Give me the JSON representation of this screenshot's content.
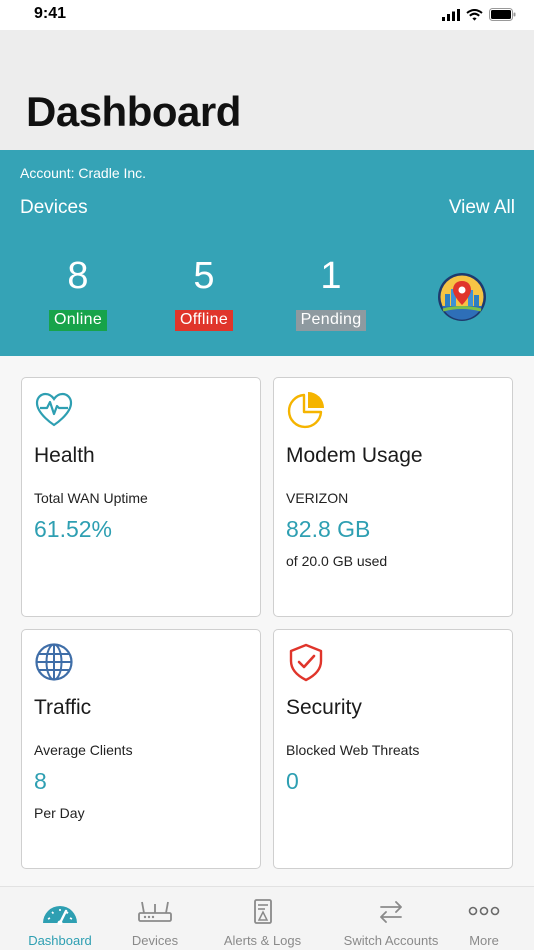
{
  "status_bar": {
    "time": "9:41"
  },
  "header": {
    "title": "Dashboard"
  },
  "devices_panel": {
    "account": "Account: Cradle Inc.",
    "label": "Devices",
    "view_all": "View All",
    "online": {
      "count": "8",
      "label": "Online"
    },
    "offline": {
      "count": "5",
      "label": "Offline"
    },
    "pending": {
      "count": "1",
      "label": "Pending"
    }
  },
  "cards": {
    "health": {
      "title": "Health",
      "subtitle": "Total WAN Uptime",
      "value": "61.52%"
    },
    "modem": {
      "title": "Modem Usage",
      "subtitle": "VERIZON",
      "value": "82.8 GB",
      "note": "of 20.0 GB used"
    },
    "traffic": {
      "title": "Traffic",
      "subtitle": "Average Clients",
      "value": "8",
      "note": "Per Day"
    },
    "security": {
      "title": "Security",
      "subtitle": "Blocked Web Threats",
      "value": "0"
    }
  },
  "tab_bar": {
    "dashboard": "Dashboard",
    "devices": "Devices",
    "alerts": "Alerts & Logs",
    "switch": "Switch Accounts",
    "more": "More"
  },
  "colors": {
    "accent": "#35a3b6",
    "value_text": "#2e9fb2",
    "online": "#17a34a",
    "offline": "#e0352b",
    "pending": "#8e9aa0",
    "modem_icon": "#f5b400",
    "security_icon": "#e0352b",
    "traffic_icon": "#3f6ea8"
  },
  "icons": {
    "status": [
      "signal-icon",
      "wifi-icon",
      "battery-icon"
    ],
    "map": "map-pin-icon",
    "cards": [
      "heart-pulse-icon",
      "pie-chart-icon",
      "globe-icon",
      "shield-check-icon"
    ],
    "tabs": [
      "gauge-icon",
      "router-icon",
      "log-icon",
      "swap-arrows-icon",
      "more-dots-icon"
    ]
  }
}
